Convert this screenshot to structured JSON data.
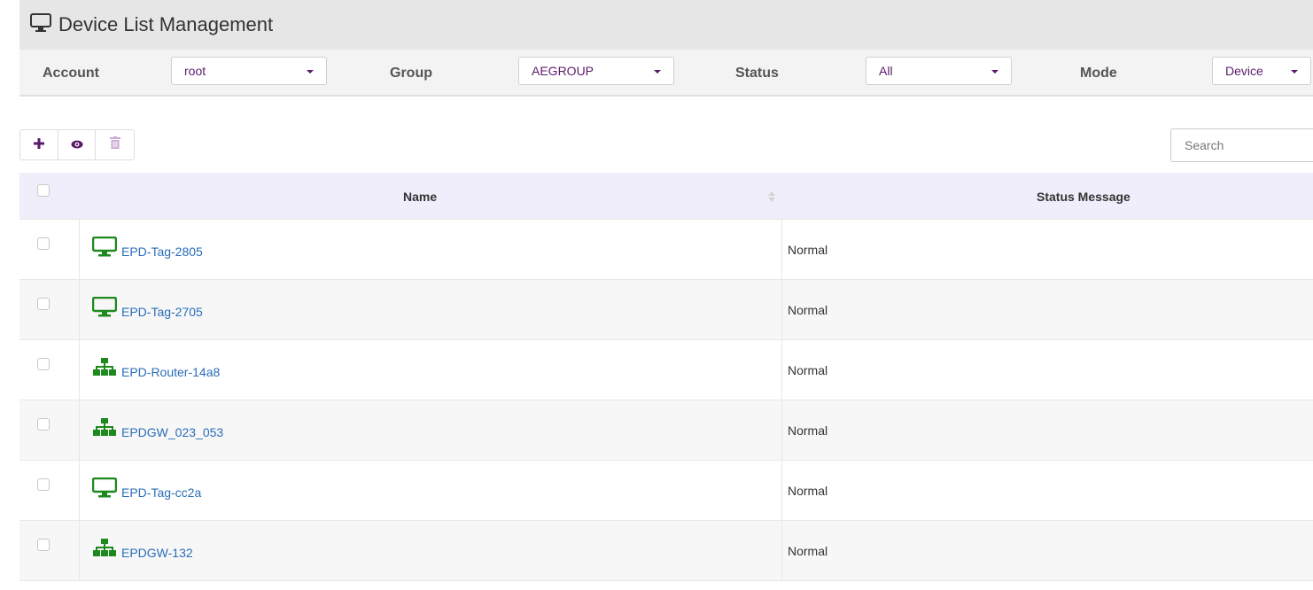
{
  "header": {
    "title": "Device List Management",
    "icon": "monitor-icon"
  },
  "filters": {
    "account": {
      "label": "Account",
      "value": "root"
    },
    "group": {
      "label": "Group",
      "value": "AEGROUP"
    },
    "status": {
      "label": "Status",
      "value": "All"
    },
    "mode": {
      "label": "Mode",
      "value": "Device"
    }
  },
  "toolbar": {
    "add_icon": "plus-icon",
    "view_icon": "eye-icon",
    "delete_icon": "trash-icon"
  },
  "search": {
    "placeholder": "Search"
  },
  "table": {
    "columns": {
      "name": "Name",
      "status_message": "Status Message"
    },
    "rows": [
      {
        "icon": "monitor-icon",
        "name": "EPD-Tag-2805",
        "status": "Normal"
      },
      {
        "icon": "monitor-icon",
        "name": "EPD-Tag-2705",
        "status": "Normal"
      },
      {
        "icon": "network-icon",
        "name": "EPD-Router-14a8",
        "status": "Normal"
      },
      {
        "icon": "network-icon",
        "name": "EPDGW_023_053",
        "status": "Normal"
      },
      {
        "icon": "monitor-icon",
        "name": "EPD-Tag-cc2a",
        "status": "Normal"
      },
      {
        "icon": "network-icon",
        "name": "EPDGW-132",
        "status": "Normal"
      }
    ]
  },
  "colors": {
    "accent": "#5c1a6b",
    "device_icon": "#1e8a1e",
    "link": "#2a6db8"
  }
}
